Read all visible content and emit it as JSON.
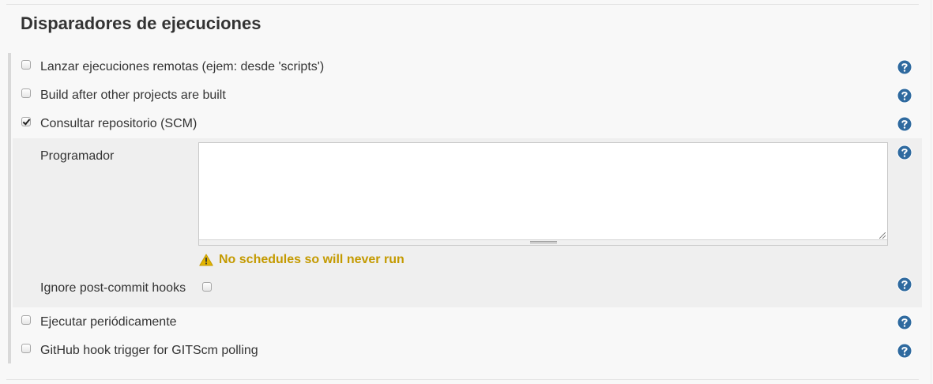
{
  "section": {
    "title": "Disparadores de ejecuciones"
  },
  "options": [
    {
      "label": "Lanzar ejecuciones remotas (ejem: desde 'scripts')",
      "checked": false,
      "help_icon": "question-circle-icon"
    },
    {
      "label": "Build after other projects are built",
      "checked": false,
      "help_icon": "question-circle-icon"
    },
    {
      "label": "Consultar repositorio (SCM)",
      "checked": true,
      "help_icon": "question-circle-icon"
    },
    {
      "label": "Ejecutar periódicamente",
      "checked": false,
      "help_icon": "question-circle-icon"
    },
    {
      "label": "GitHub hook trigger for GITScm polling",
      "checked": false,
      "help_icon": "question-circle-icon"
    }
  ],
  "scm": {
    "schedule_label": "Programador",
    "schedule_value": "",
    "warning_icon": "warning-triangle-icon",
    "warning": "No schedules so will never run",
    "ignore_hooks_label": "Ignore post-commit hooks",
    "ignore_hooks_checked": false
  },
  "colors": {
    "help_icon": "#2f6a9f",
    "warning_text": "#c49a00",
    "warning_icon": "#e2b400",
    "nested_background": "#efefef",
    "page_background": "#f8f8f8"
  }
}
